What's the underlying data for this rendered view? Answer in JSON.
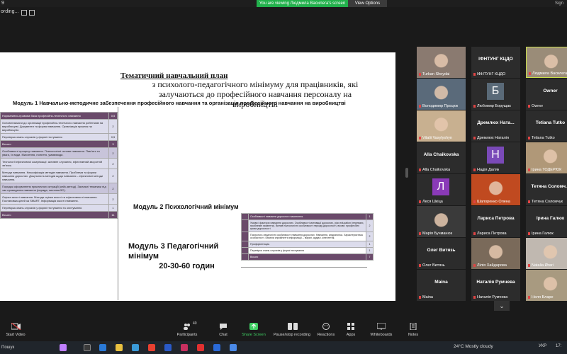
{
  "topbar": {
    "number": "9",
    "share_banner": "You are viewing Людмила Василега's screen",
    "view_options": "View Options",
    "sign": "Sign"
  },
  "recording": {
    "label": "ording..."
  },
  "document": {
    "title": "Тематичний навчальний план",
    "subtitle": "з психолого-педагогічного мінімуму для працівників, які залучаються до професійного навчання персоналу на виробництві",
    "module1": "Модуль 1 Навчально-методичне забезпечення професійного навчання та організація професійного навчання на виробництві",
    "module2": "Модуль 2 Психологічний мінімум",
    "module3_line1": "Модуль 3 Педагогічний мінімум",
    "module3_line2": "20-30-60 годин",
    "table1": [
      {
        "style": "dark",
        "text": "Нормативно-правова база професійно-технічного навчання",
        "n": "0,5"
      },
      {
        "style": "light",
        "text": "Основні вимоги до організації професійно-технічного навчання робітників на виробництві. Документи та форми навчання. Організація практик на виробництві.",
        "n": "2"
      },
      {
        "style": "light",
        "text": "Перевірка знань слухачів у формі тестування",
        "n": "0,5"
      },
      {
        "style": "dark",
        "text": "Всього",
        "n": "3"
      },
      {
        "style": "mid",
        "text": "Особливості процесу навчання. Психологічні основи навчання. Пам'ять та увага, їх види. Мислення, поняття, умовиводи.",
        "n": "2"
      },
      {
        "style": "light",
        "text": "Технології ефективної комунікації: активне слухання, ефективний зворотній зв'язок.",
        "n": "2"
      },
      {
        "style": "light",
        "text": "Методи навчання. Класифікація методів навчання. Проблема та форми навчання дорослих. Доцільність методів щодо навчання – ефективні методи навчання.",
        "n": "2"
      },
      {
        "style": "mid",
        "text": "Порядок оформлення практичних ситуацій (кейс-метод). Загальні тематики під час проведення навчання (порада, система 5С).",
        "n": "2"
      },
      {
        "style": "light",
        "text": "Оцінка якості навчання. Методи оцінки якості та ефективності навчання. Постановка цілей за SMART. Інформація якості навчання.",
        "n": "2"
      },
      {
        "style": "light",
        "text": "Перевірка знань слухачів у формі тестування та опитування",
        "n": "1"
      },
      {
        "style": "dark",
        "text": "Всього",
        "n": "11"
      }
    ],
    "table2": [
      {
        "style": "hdr",
        "text": "Особливості навчання дорослого населення.",
        "n": "1"
      },
      {
        "style": "light",
        "text": "Умови і фактори навчання дорослих. Особливості мотивації дорослих, ріки education (переваги, проблемні моменти). Вплив психологічні особливості періоду дорослості, вікові і професійні кризи дорослості",
        "n": "2"
      },
      {
        "style": "plain",
        "text": "Психолого-педагогічні особливості навчання дорослих. Навчання, андрагогіка. Характеристика особистості. Канали сприйняття інформації – візуал, аудіал, кінестетик.",
        "n": "2"
      },
      {
        "style": "light",
        "text": "Профорієнтація.",
        "n": "1"
      },
      {
        "style": "plain",
        "text": "Перевірка знань слухачів у формі тестування",
        "n": "1"
      },
      {
        "style": "hdr",
        "text": "Всього",
        "n": "7"
      }
    ]
  },
  "gallery": {
    "tiles": [
      {
        "name": "Turkan Sheydai",
        "kind": "photo",
        "bg": "#8a7a70"
      },
      {
        "name": "ІФНТУНГ КЦДО",
        "kind": "name",
        "bg": "#2c2c2c",
        "label": "ІФНТУНГ КЦДО"
      },
      {
        "name": "Людмила Василега",
        "kind": "photo",
        "bg": "#9a8c78",
        "active": true
      },
      {
        "name": "Володимир Процюк",
        "kind": "photo",
        "bg": "#5a6a7a"
      },
      {
        "name": "Любомир Борущак",
        "kind": "letter",
        "bg": "#2c2c2c",
        "letter": "Б",
        "letter_bg": "#5a6a78"
      },
      {
        "name": "Owner",
        "kind": "name",
        "bg": "#2c2c2c",
        "label": "Owner"
      },
      {
        "name": "Vitalii Vasylyshyn",
        "kind": "photo",
        "bg": "#c8b090"
      },
      {
        "name": "Дремлюх Наталія",
        "kind": "name",
        "bg": "#2c2c2c",
        "label": "Дремлюх Ната..."
      },
      {
        "name": "Tetiana Tutko",
        "kind": "name",
        "bg": "#2c2c2c",
        "label": "Tetiana Tutko"
      },
      {
        "name": "Alla Chaikovska",
        "kind": "name",
        "bg": "#2c2c2c",
        "label": "Alla Chaikovska"
      },
      {
        "name": "Надія Даляк",
        "kind": "letter",
        "bg": "#2c2c2c",
        "letter": "Н",
        "letter_bg": "#7a4ab8"
      },
      {
        "name": "Ірина ТОДЕРЮК",
        "kind": "photo",
        "bg": "#b09878"
      },
      {
        "name": "Леся Шкіца",
        "kind": "letter",
        "bg": "#2c2c2c",
        "letter": "Л",
        "letter_bg": "#8a3ab8"
      },
      {
        "name": "Шапоренко Олена",
        "kind": "photo",
        "bg": "#c04a20"
      },
      {
        "name": "Тетяна Соломчук",
        "kind": "name",
        "bg": "#2c2c2c",
        "label": "Тетяна Соломч..."
      },
      {
        "name": "Марія Бучманюк",
        "kind": "photo",
        "bg": "#3a3a3a"
      },
      {
        "name": "Лариса Петрова",
        "kind": "name",
        "bg": "#2c2c2c",
        "label": "Лариса Петрова"
      },
      {
        "name": "Ірина Галюк",
        "kind": "name",
        "bg": "#2c2c2c",
        "label": "Ірина Галюк"
      },
      {
        "name": "Олег Витязь",
        "kind": "name",
        "bg": "#2c2c2c",
        "label": "Олег Витязь"
      },
      {
        "name": "Лілія Хайдарова",
        "kind": "photo",
        "bg": "#7a6a5a"
      },
      {
        "name": "Natalia Ørari",
        "kind": "photo",
        "bg": "#c0b8b0"
      },
      {
        "name": "Maina",
        "kind": "name",
        "bg": "#2c2c2c",
        "label": "Maina"
      },
      {
        "name": "Наталія Румчева",
        "kind": "name",
        "bg": "#2c2c2c",
        "label": "Наталія Румчева"
      },
      {
        "name": "Неля Бларе",
        "kind": "photo",
        "bg": "#a89a80"
      }
    ],
    "more_icon": "chevron-down"
  },
  "toolbar": {
    "start_video": "Start Video",
    "participants": "Participants",
    "participants_count": "40",
    "chat": "Chat",
    "share_screen": "Share Screen",
    "pause_recording": "Pause/stop recording",
    "reactions": "Reactions",
    "apps": "Apps",
    "whiteboards": "Whiteboards",
    "notes": "Notes",
    "end": "End"
  },
  "taskbar": {
    "search": "Пошук",
    "weather": "24°C  Mostly cloudy",
    "lang": "УКР",
    "time": "17:"
  },
  "colors": {
    "share_green": "#22b14c",
    "end_red": "#c43d3d",
    "table_dark": "#6a4a6a",
    "table_light": "#dcdcec"
  }
}
